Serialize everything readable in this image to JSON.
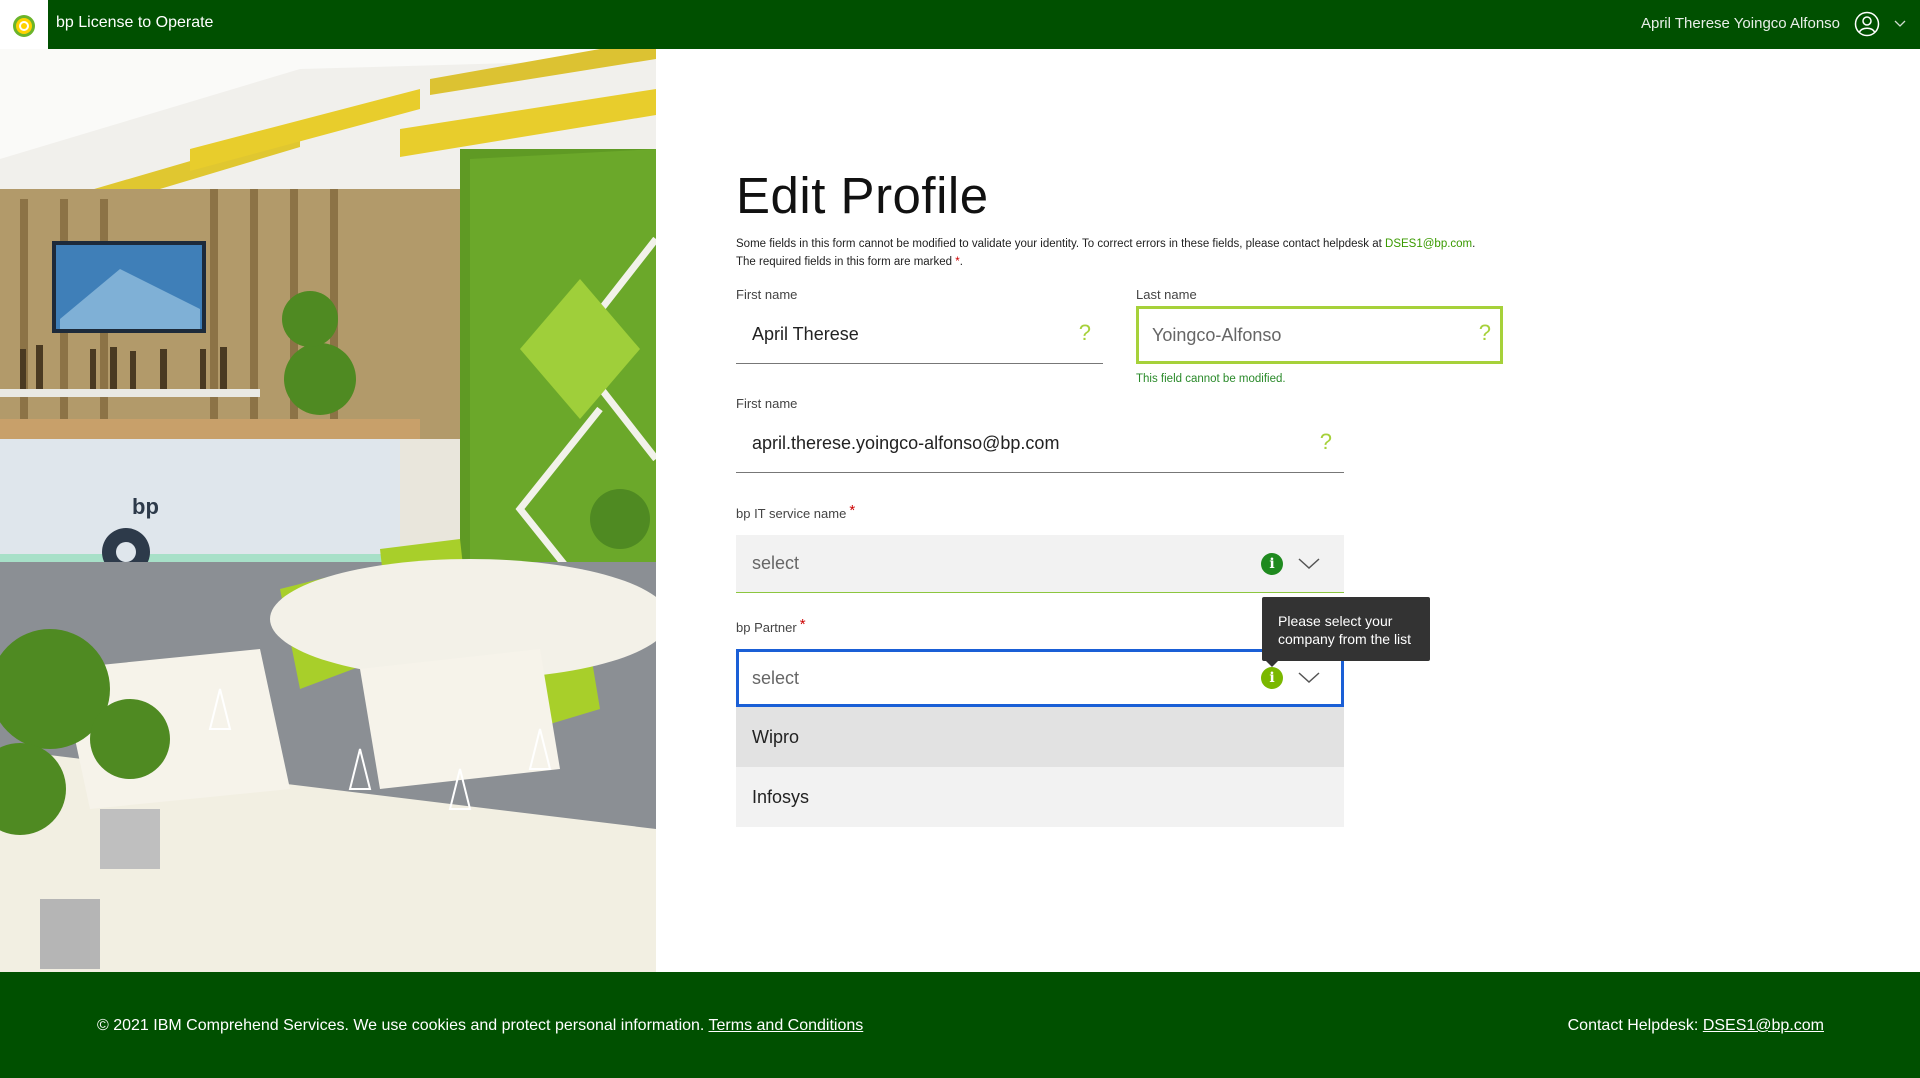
{
  "header": {
    "app_title": "bp License to Operate",
    "user_name": "April Therese Yoingco Alfonso"
  },
  "form": {
    "title": "Edit Profile",
    "intro_line1": "Some fields in this form cannot be modified to validate your identity. To correct errors in these fields, please contact helpdesk at ",
    "intro_link": "DSES1@bp.com",
    "intro_line1_end": ".",
    "intro_line2": "The required fields in this form are marked ",
    "intro_req_mark": "*",
    "intro_line2_end": ".",
    "first_name": {
      "label": "First name",
      "value": "April Therese"
    },
    "last_name": {
      "label": "Last name",
      "value": "Yoingco-Alfonso",
      "message": "This field cannot be modified."
    },
    "email": {
      "label": "First name",
      "value": "april.therese.yoingco-alfonso@bp.com"
    },
    "it_service": {
      "label": "bp IT service name",
      "required_mark": "*",
      "placeholder": "select"
    },
    "partner": {
      "label": "bp Partner",
      "required_mark": "*",
      "placeholder": "select",
      "tooltip_line1": "Please select your",
      "tooltip_line2": "company from the list",
      "options": [
        "Wipro",
        "Infosys"
      ]
    },
    "help_glyph": "?"
  },
  "footer": {
    "copyright": "© 2021 IBM Comprehend Services. We use cookies and protect personal information.",
    "terms_link": "Terms and Conditions",
    "helpdesk_label": "Contact Helpdesk:",
    "helpdesk_email": "DSES1@bp.com"
  },
  "colors": {
    "brand_green": "#005000",
    "accent_lime": "#a6d13a",
    "info_green": "#1f8a1f",
    "focus_blue": "#1a5fd6",
    "error_red": "#cc0000"
  },
  "icons": [
    "bp-helios-logo",
    "user-circle-icon",
    "chevron-down-icon",
    "help-question-icon",
    "info-icon"
  ]
}
